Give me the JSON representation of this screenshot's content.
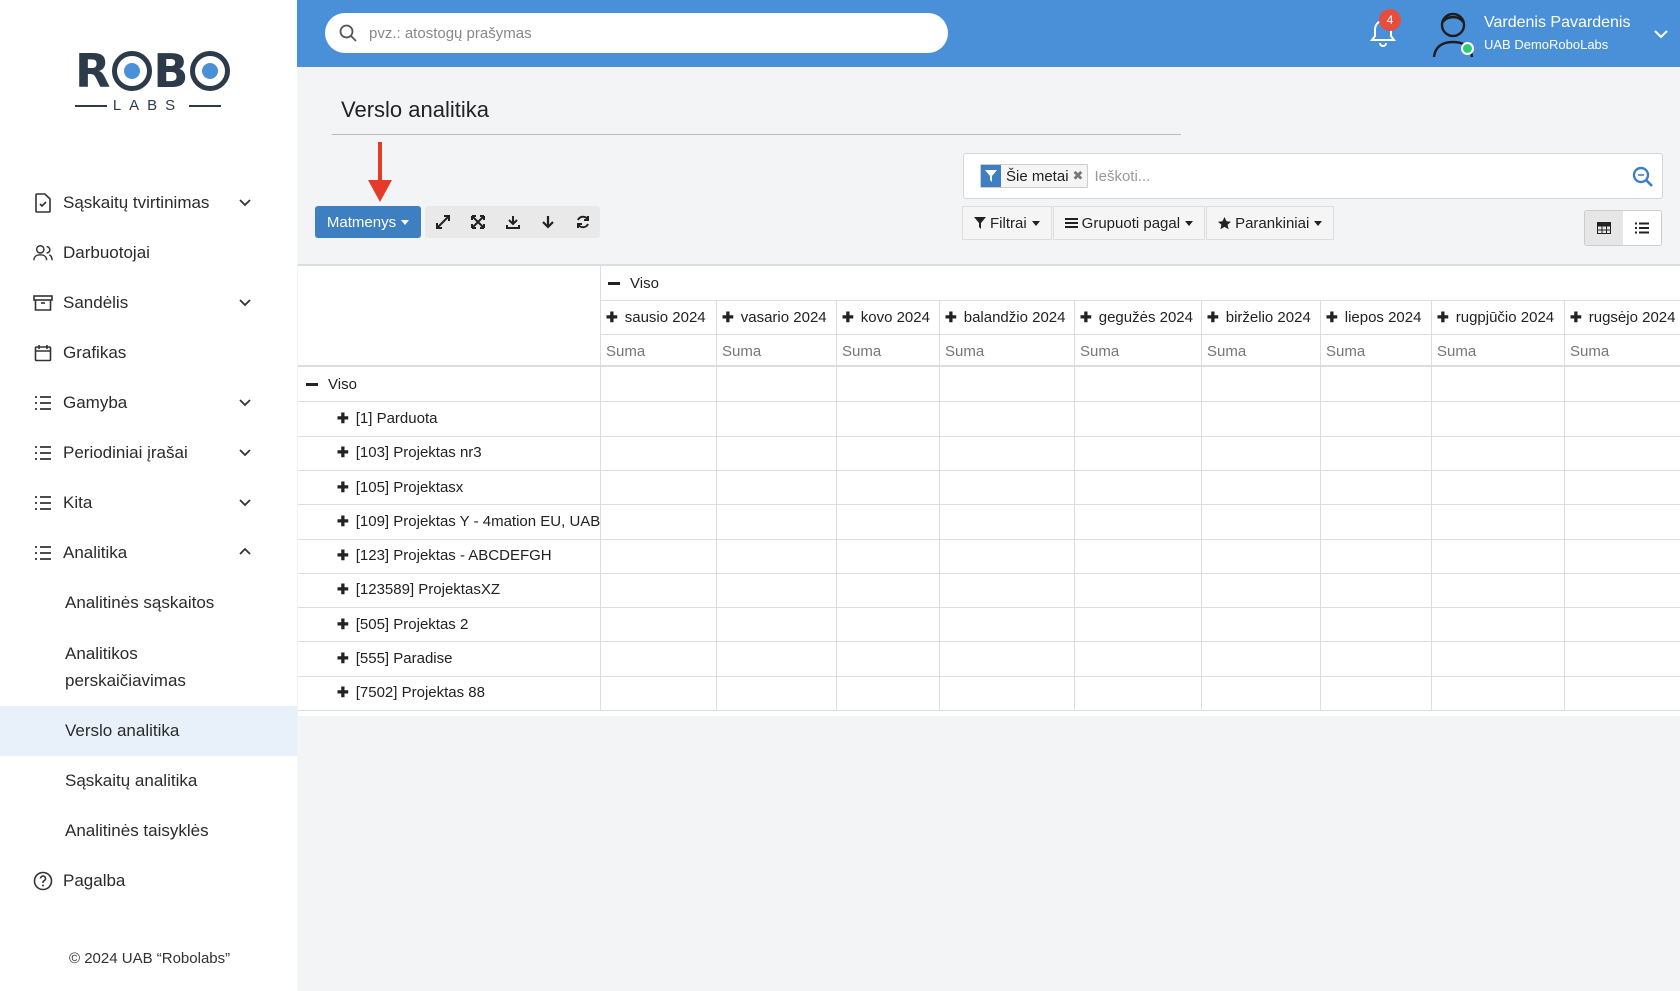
{
  "logo": {
    "main": "ROBO",
    "sub": "LABS"
  },
  "sidebar": {
    "items": [
      {
        "label": "Sąskaitų tvirtinimas",
        "icon": "document-check-icon",
        "chevron": "down"
      },
      {
        "label": "Darbuotojai",
        "icon": "users-icon"
      },
      {
        "label": "Sandėlis",
        "icon": "archive-box-icon",
        "chevron": "down"
      },
      {
        "label": "Grafikas",
        "icon": "calendar-icon"
      },
      {
        "label": "Gamyba",
        "icon": "list-icon",
        "chevron": "down"
      },
      {
        "label": "Periodiniai įrašai",
        "icon": "list-icon",
        "chevron": "down"
      },
      {
        "label": "Kita",
        "icon": "list-icon",
        "chevron": "down"
      },
      {
        "label": "Analitika",
        "icon": "list-icon",
        "chevron": "up"
      }
    ],
    "sub_items": [
      "Analitinės sąskaitos",
      "Analitikos perskaičiavimas",
      "Verslo analitika",
      "Sąskaitų analitika",
      "Analitinės taisyklės"
    ],
    "help": "Pagalba",
    "copyright": "© 2024 UAB “Robolabs”"
  },
  "topbar": {
    "search_placeholder": "pvz.: atostogų prašymas",
    "notification_count": "4",
    "user_name": "Vardenis Pavardenis",
    "company": "UAB DemoRoboLabs",
    "bg_color": "#4a90d9"
  },
  "page": {
    "title": "Verslo analitika"
  },
  "toolbar": {
    "dimensions_label": "Matmenys",
    "icons": [
      "expand-arrows-icon",
      "fullscreen-icon",
      "download-icon",
      "arrow-down-icon",
      "refresh-icon"
    ]
  },
  "search": {
    "facet": "Šie metai",
    "placeholder": "Ieškoti..."
  },
  "filters": {
    "filter_label": "Filtrai",
    "group_label": "Grupuoti pagal",
    "favorites_label": "Parankiniai"
  },
  "pivot": {
    "total_label": "Viso",
    "measure": "Suma",
    "columns": [
      "sausio 2024",
      "vasario 2024",
      "kovo 2024",
      "balandžio 2024",
      "gegužės 2024",
      "birželio 2024",
      "liepos 2024",
      "rugpjūčio 2024",
      "rugsėjo 2024"
    ],
    "rows": [
      "[1] Parduota",
      "[103] Projektas nr3",
      "[105] Projektasx",
      "[109] Projektas Y - 4mation EU, UAB",
      "[123] Projektas - ABCDEFGH",
      "[123589] ProjektasXZ",
      "[505] Projektas 2",
      "[555] Paradise",
      "[7502] Projektas 88"
    ]
  }
}
